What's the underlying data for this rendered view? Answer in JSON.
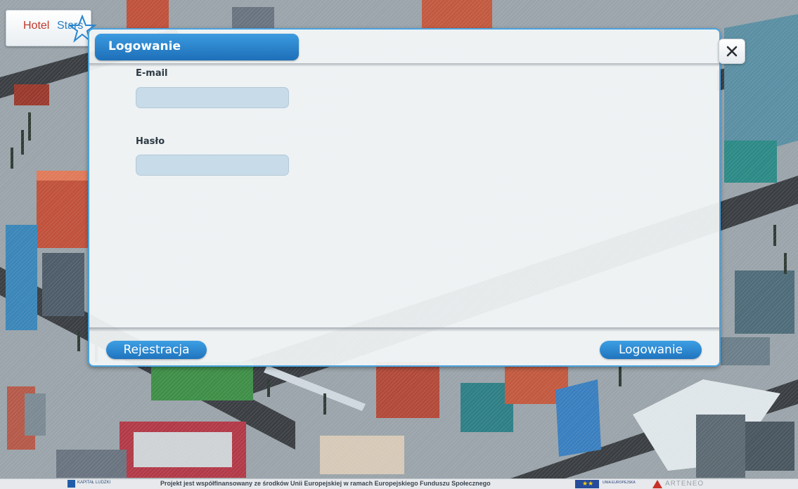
{
  "app": {
    "logo_hotel": "Hotel",
    "logo_stars": "Stars"
  },
  "dialog": {
    "title": "Logowanie",
    "email_label": "E-mail",
    "email_value": "",
    "password_label": "Hasło",
    "password_value": "",
    "register_button": "Rejestracja",
    "login_button": "Logowanie",
    "close_icon": "close-icon"
  },
  "footer": {
    "kapital_text": "KAPITAŁ LUDZKI",
    "project_text": "Projekt jest współfinansowany ze środków Unii Europejskiej w ramach Europejskiego Funduszu Społecznego",
    "eu_text": "UNIA EUROPEJSKA",
    "arteneo_text": "ARTENEO"
  },
  "colors": {
    "accent": "#2a86d0",
    "dialog_border": "#4ba3df",
    "input_bg": "#c8dbe9"
  }
}
